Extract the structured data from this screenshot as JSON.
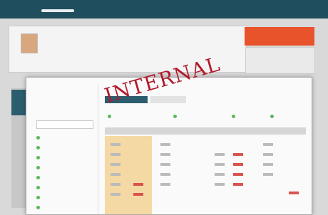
{
  "stamp": "INTERNAL"
}
